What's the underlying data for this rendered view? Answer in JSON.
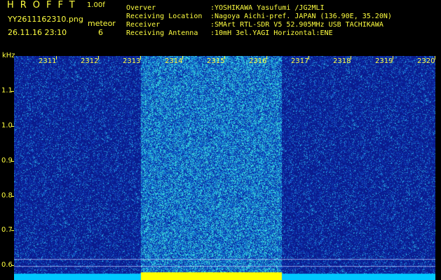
{
  "header": {
    "app_title": "HROFFT",
    "version": "1.00f",
    "filename": "YY2611162310.png",
    "datetime": "26.11.16 23:10",
    "meteor_label": "meteor",
    "meteor_count": "6"
  },
  "info": [
    {
      "key": "Overver",
      "value": ":YOSHIKAWA Yasufumi /JG2MLI"
    },
    {
      "key": "Receiving Location",
      "value": ":Nagoya Aichi-pref. JAPAN (136.90E, 35.20N)"
    },
    {
      "key": "Receiver",
      "value": ":SMArt RTL-SDR V5 52.905MHz USB TACHIKAWA"
    },
    {
      "key": "Receiving Antenna",
      "value": ":10mH 3el.YAGI Horizontal:ENE"
    }
  ],
  "axes": {
    "y_unit": "kHz",
    "y_ticks": [
      "1.1",
      "1.0",
      "0.9",
      "0.8",
      "0.7",
      "0.6"
    ],
    "x_ticks": [
      "2311",
      "2312",
      "2313",
      "2314",
      "2315",
      "2316",
      "2317",
      "2318",
      "2319",
      "2320"
    ]
  },
  "colors": {
    "text": "#ffff40",
    "background": "#0b1c8a",
    "band": "#ffff00",
    "baseline": "#00c8ff"
  }
}
